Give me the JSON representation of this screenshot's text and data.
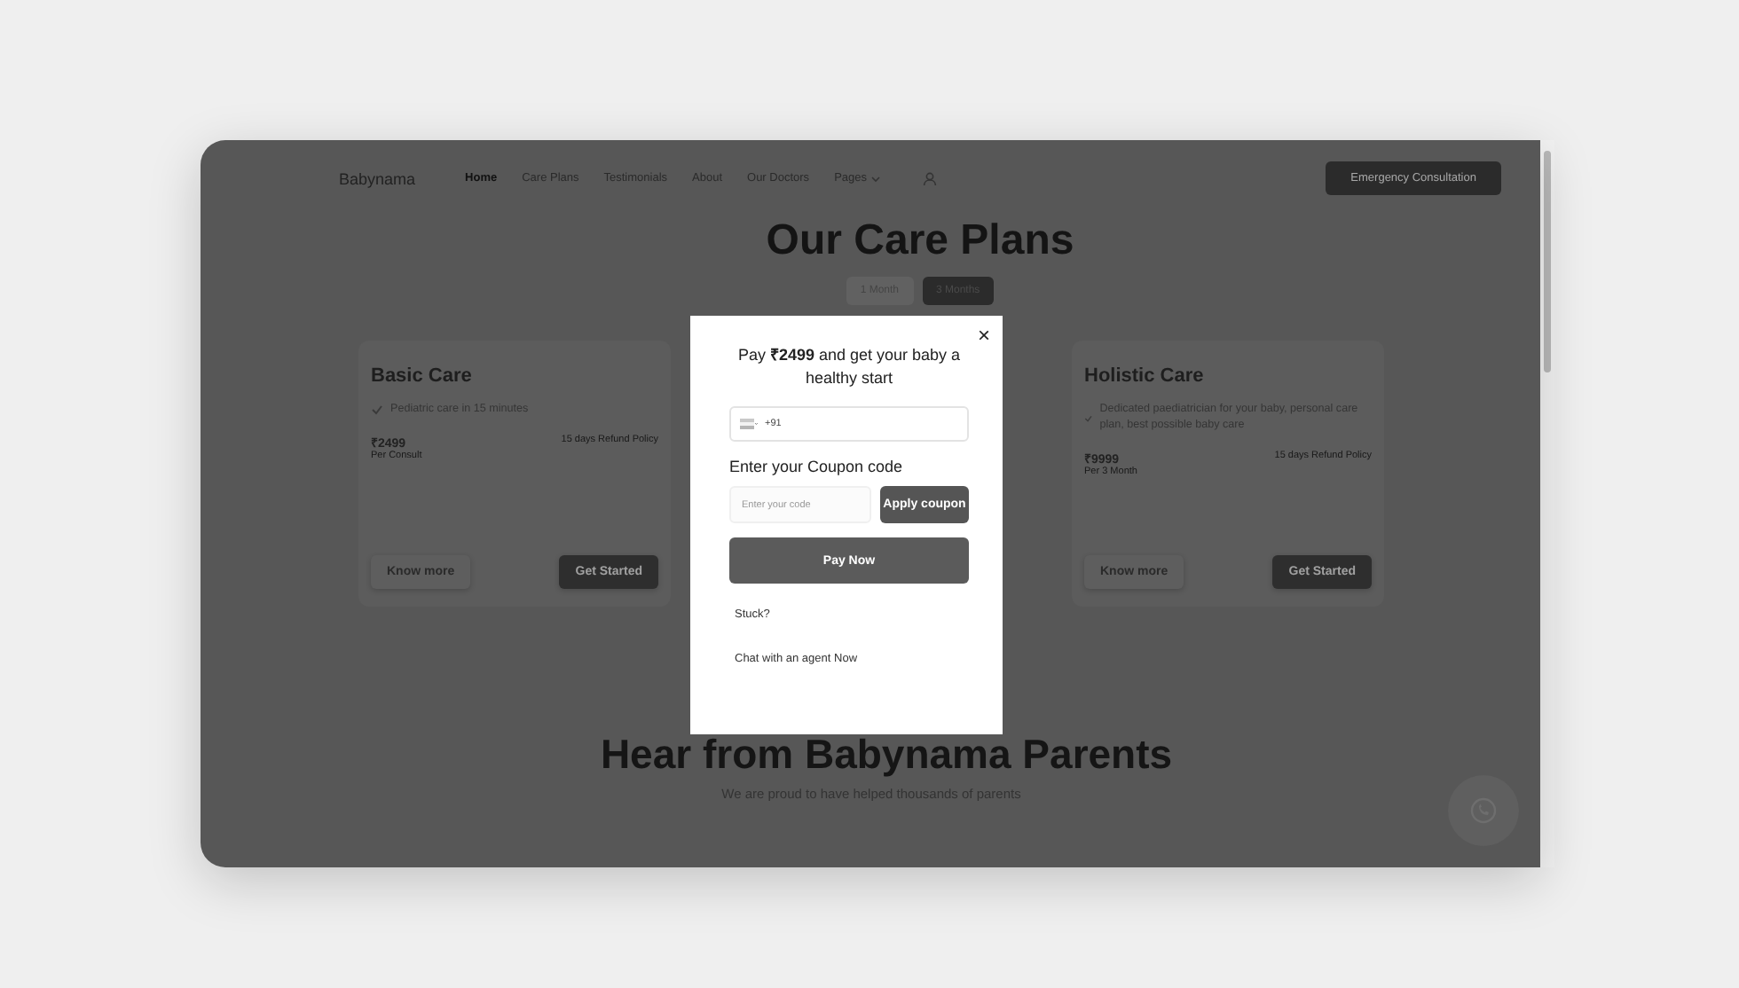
{
  "nav": {
    "logo": "Babynama",
    "links": [
      {
        "label": "Home",
        "selected": true
      },
      {
        "label": "Care Plans",
        "selected": false
      },
      {
        "label": "Testimonials",
        "selected": false
      },
      {
        "label": "About",
        "selected": false
      },
      {
        "label": "Our Doctors",
        "selected": false
      },
      {
        "label": "Pages",
        "selected": false,
        "dropdown": true
      }
    ],
    "cta": "Emergency Consultation"
  },
  "plans": {
    "title": "Our Care Plans",
    "durations": [
      {
        "label": "1 Month",
        "selected": false
      },
      {
        "label": "3 Months",
        "selected": true
      }
    ],
    "cards": [
      {
        "name": "Basic Care",
        "feature": "Pediatric care in 15 minutes",
        "price": "₹2499",
        "price_note": "Per Consult",
        "refund": "15 days Refund Policy",
        "secondary": "Know more",
        "primary": "Get Started"
      },
      {
        "name": "Holistic Care",
        "feature": "Dedicated paediatrician for your baby, personal care plan, best possible baby care",
        "price": "₹9999",
        "price_note": "Per 3 Month",
        "refund": "15 days Refund Policy",
        "secondary": "Know more",
        "primary": "Get Started"
      }
    ]
  },
  "testimonials": {
    "title": "Hear from Babynama Parents",
    "subtitle": "We are proud to have helped thousands of parents"
  },
  "modal": {
    "close": "×",
    "heading": "Pay **₹2499** and get your baby a healthy start",
    "phone_code": "+91",
    "coupon_label": "Enter your Coupon code",
    "coupon_placeholder": "Enter your code",
    "apply": "Apply coupon",
    "pay": "Pay Now",
    "stuck": "Stuck?",
    "chat": "Chat with an agent Now"
  }
}
